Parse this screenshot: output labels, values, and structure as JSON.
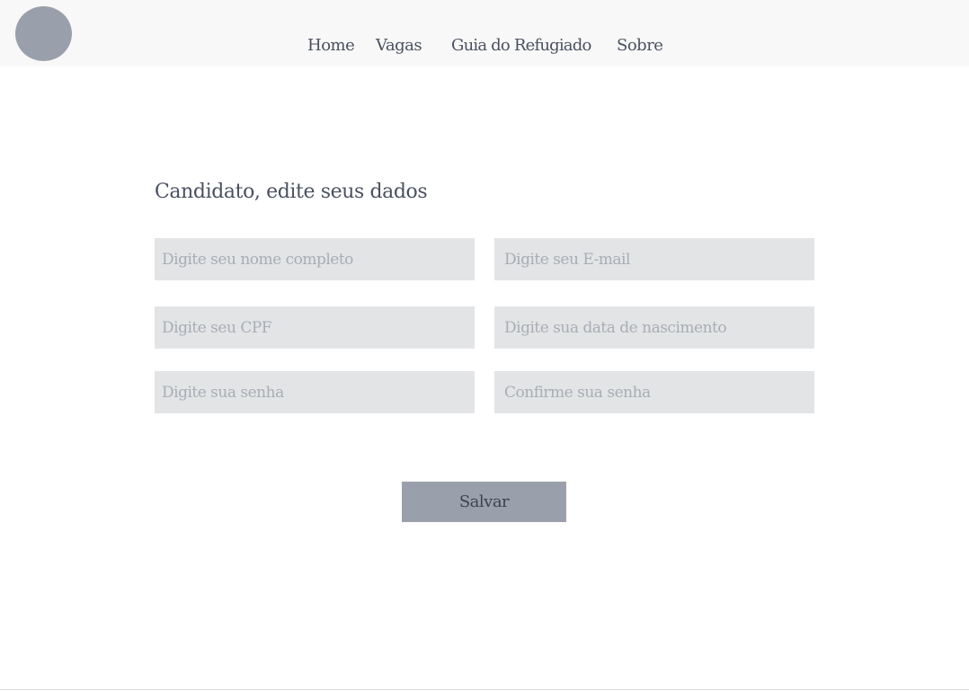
{
  "header": {
    "nav": [
      {
        "label": "Home"
      },
      {
        "label": "Vagas"
      },
      {
        "label": "Guia do Refugiado"
      },
      {
        "label": "Sobre"
      }
    ]
  },
  "form": {
    "title": "Candidato, edite seus dados",
    "fields": {
      "nome": {
        "value": "",
        "placeholder": "Digite seu nome completo"
      },
      "email": {
        "value": "",
        "placeholder": "Digite seu E-mail"
      },
      "cpf": {
        "value": "",
        "placeholder": "Digite seu CPF"
      },
      "nascimento": {
        "value": "",
        "placeholder": "Digite sua data de nascimento"
      },
      "senha": {
        "value": "",
        "placeholder": "Digite sua senha"
      },
      "confirmar_senha": {
        "value": "",
        "placeholder": "Confirme sua senha"
      }
    },
    "submit_label": "Salvar"
  },
  "colors": {
    "header_bg": "#f8f8f8",
    "logo": "#9aa0ab",
    "input_bg": "#e3e4e6",
    "button_bg": "#9aa0ab",
    "text": "#4a5160"
  }
}
